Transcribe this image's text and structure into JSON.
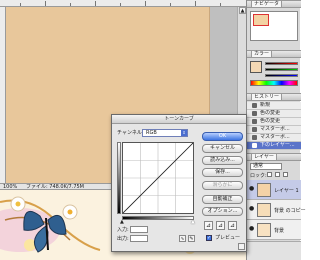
{
  "statusbar": {
    "zoom": "100%",
    "fileinfo": "ファイル: 748.0K/7.75M"
  },
  "panels": {
    "navigator_tab": "ナビゲータ",
    "color_tab": "カラー",
    "history_tab": "ヒストリー",
    "history_items": [
      "新規",
      "色の変更",
      "色の変更",
      "マスターボ...",
      "マスターボ...",
      "下のレイヤー..."
    ],
    "layers_tab": "レイヤー",
    "blend_mode": "通常",
    "lock_label": "ロック:",
    "layers": [
      "レイヤー 1",
      "背景 のコピー",
      "背景"
    ]
  },
  "curves": {
    "title": "トーンカーブ",
    "channel_label": "チャンネル:",
    "channel_value": "RGB",
    "ok": "OK",
    "cancel": "キャンセル",
    "load": "読み込み...",
    "save": "保存...",
    "smooth": "滑らかに",
    "auto": "自動補正",
    "options": "オプション...",
    "input_label": "入力:",
    "output_label": "出力:",
    "preview_label": "プレビュー"
  },
  "colors": {
    "canvas": "#e8c79b",
    "dialog_bg": "#e6e6e6",
    "accent": "#3d74e2",
    "history_selected": "#5b74c9"
  }
}
